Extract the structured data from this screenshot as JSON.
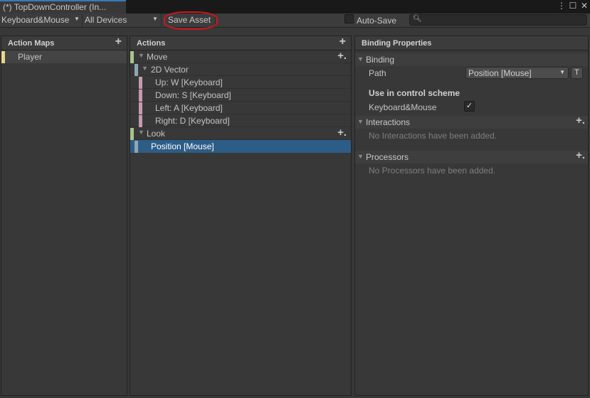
{
  "window": {
    "tab_title": "(*) TopDownController (In...",
    "controls": {
      "more": "⋮",
      "maximize": "☐",
      "close": "✕"
    }
  },
  "toolbar": {
    "scheme_dropdown": "Keyboard&Mouse",
    "devices_dropdown": "All Devices",
    "save_asset": "Save Asset",
    "auto_save_label": "Auto-Save",
    "auto_save_checked": false,
    "search_value": "",
    "search_icon": "search-icon"
  },
  "action_maps": {
    "header": "Action Maps",
    "add": "+",
    "items": [
      {
        "label": "Player",
        "color": "#e8d68b"
      }
    ]
  },
  "actions": {
    "header": "Actions",
    "add": "+",
    "items": [
      {
        "label": "Move",
        "type": "action",
        "color": "#a9c48c",
        "add": "+."
      },
      {
        "label": "2D Vector",
        "type": "composite",
        "color": "#8fa7b2"
      },
      {
        "label": "Up: W [Keyboard]",
        "type": "part",
        "color": "#c59ab0"
      },
      {
        "label": "Down: S [Keyboard]",
        "type": "part",
        "color": "#c59ab0"
      },
      {
        "label": "Left: A [Keyboard]",
        "type": "part",
        "color": "#c59ab0"
      },
      {
        "label": "Right: D [Keyboard]",
        "type": "part",
        "color": "#c59ab0"
      },
      {
        "label": "Look",
        "type": "action",
        "color": "#a9c48c",
        "add": "+."
      },
      {
        "label": "Position [Mouse]",
        "type": "binding",
        "color": "#8fa7b2",
        "selected": true
      }
    ]
  },
  "binding_properties": {
    "header": "Binding Properties",
    "binding_section": "Binding",
    "path_label": "Path",
    "path_value": "Position [Mouse]",
    "t_button": "T",
    "control_scheme_title": "Use in control scheme",
    "scheme_name": "Keyboard&Mouse",
    "scheme_checked": "✓",
    "interactions_section": "Interactions",
    "interactions_empty": "No Interactions have been added.",
    "processors_section": "Processors",
    "processors_empty": "No Processors have been added.",
    "add": "+."
  }
}
